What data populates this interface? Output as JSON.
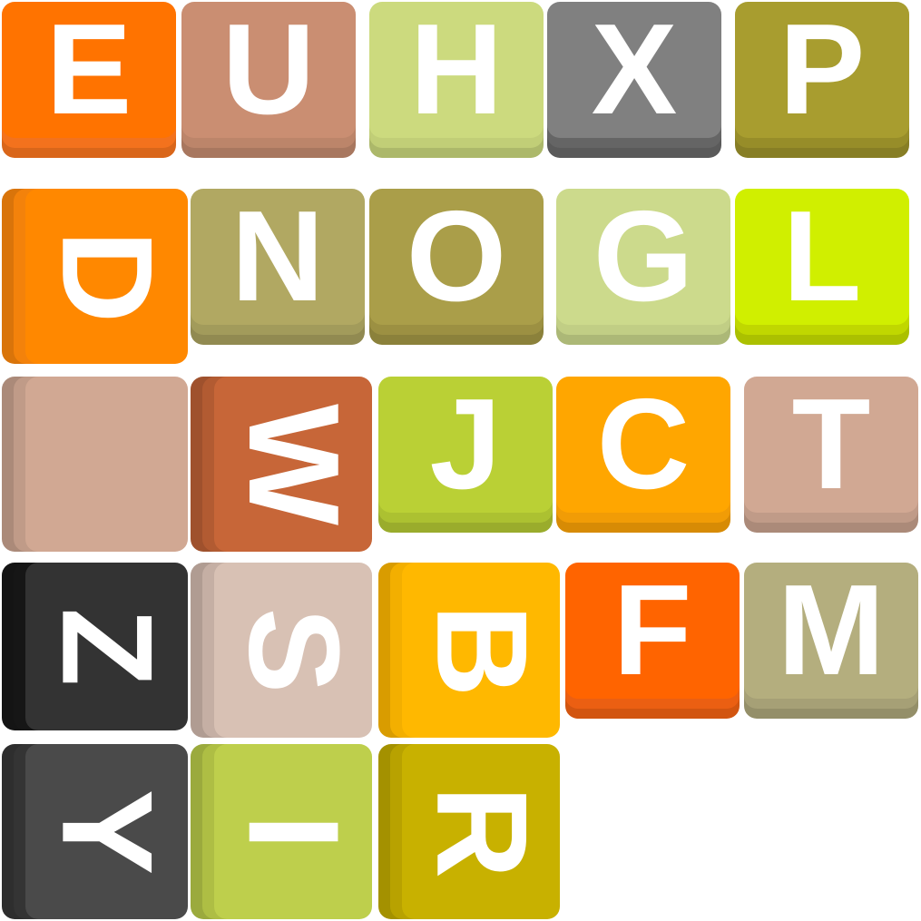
{
  "board": {
    "tiles": [
      {
        "letter": "E",
        "face": "#FF7300",
        "side": "#D9661A",
        "dir": "down",
        "rot": 0
      },
      {
        "letter": "U",
        "face": "#CA8E72",
        "side": "#A8775F",
        "dir": "down",
        "rot": 0
      },
      {
        "letter": "H",
        "face": "#CCDA7E",
        "side": "#ACB86A",
        "dir": "down",
        "rot": 0
      },
      {
        "letter": "X",
        "face": "#808080",
        "side": "#5A5A5A",
        "dir": "down",
        "rot": 0
      },
      {
        "letter": "P",
        "face": "#A89D2F",
        "side": "#877E25",
        "dir": "down",
        "rot": 0
      },
      {
        "letter": "D",
        "face": "#FF8800",
        "side": "#D9740A",
        "dir": "left",
        "rot": 90
      },
      {
        "letter": "N",
        "face": "#B1A862",
        "side": "#918A51",
        "dir": "down",
        "rot": 0
      },
      {
        "letter": "O",
        "face": "#AA9E49",
        "side": "#8B813B",
        "dir": "down",
        "rot": 0
      },
      {
        "letter": "G",
        "face": "#CCDA8C",
        "side": "#ACB877",
        "dir": "down",
        "rot": 0
      },
      {
        "letter": "L",
        "face": "#D0EF00",
        "side": "#ABC000",
        "dir": "down",
        "rot": 0
      },
      {
        "letter": "",
        "face": "#D1A893",
        "side": "#AB8A79",
        "dir": "left",
        "rot": 0
      },
      {
        "letter": "W",
        "face": "#C76638",
        "side": "#9F512D",
        "dir": "left",
        "rot": 90
      },
      {
        "letter": "J",
        "face": "#BAD035",
        "side": "#9AAC2C",
        "dir": "down",
        "rot": 0
      },
      {
        "letter": "C",
        "face": "#FFA600",
        "side": "#D78B05",
        "dir": "down",
        "rot": 0
      },
      {
        "letter": "T",
        "face": "#D1A893",
        "side": "#AB8A79",
        "dir": "down",
        "rot": 0
      },
      {
        "letter": "Z",
        "face": "#333333",
        "side": "#141414",
        "dir": "left",
        "rot": 90
      },
      {
        "letter": "S",
        "face": "#D8C1B4",
        "side": "#B09C92",
        "dir": "left",
        "rot": 90
      },
      {
        "letter": "B",
        "face": "#FFB800",
        "side": "#D99C00",
        "dir": "left",
        "rot": 90
      },
      {
        "letter": "F",
        "face": "#FF6400",
        "side": "#D25510",
        "dir": "down",
        "rot": 0
      },
      {
        "letter": "M",
        "face": "#B4AE7E",
        "side": "#948F69",
        "dir": "down",
        "rot": 0
      },
      {
        "letter": "Y",
        "face": "#4A4A4A",
        "side": "#2E2E2E",
        "dir": "left",
        "rot": 90
      },
      {
        "letter": "I",
        "face": "#BECF4C",
        "side": "#9BAA3D",
        "dir": "left",
        "rot": 90
      },
      {
        "letter": "R",
        "face": "#C8B100",
        "side": "#A49100",
        "dir": "left",
        "rot": 90
      }
    ]
  }
}
